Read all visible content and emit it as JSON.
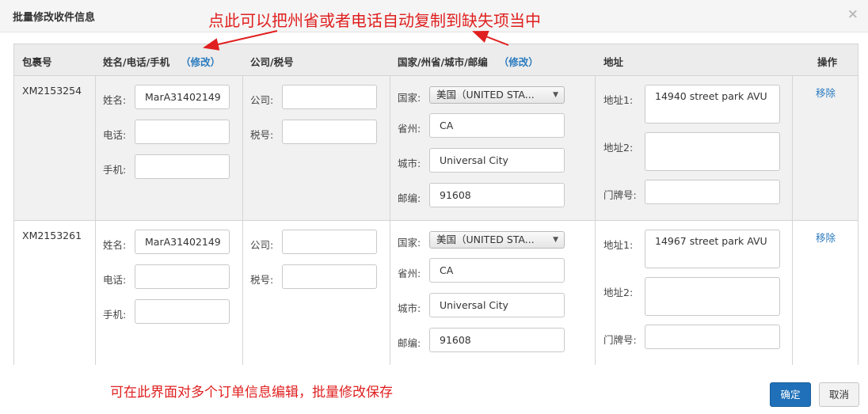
{
  "dialog": {
    "title": "批量修改收件信息",
    "close": "×",
    "annotation_top": "点此可以把州省或者电话自动复制到缺失项当中",
    "annotation_bottom": "可在此界面对多个订单信息编辑，批量修改保存",
    "annotation_color": "#e02020"
  },
  "table": {
    "headers": {
      "package": "包裹号",
      "name_phone": "姓名/电话/手机",
      "company_tax": "公司/税号",
      "region": "国家/州省/城市/邮编",
      "address": "地址",
      "actions": "操作",
      "edit_link": "（修改）"
    },
    "labels": {
      "name": "姓名:",
      "phone": "电话:",
      "mobile": "手机:",
      "company": "公司:",
      "tax": "税号:",
      "country": "国家:",
      "state": "省州:",
      "city": "城市:",
      "zip": "邮编:",
      "address1": "地址1:",
      "address2": "地址2:",
      "house_no": "门牌号:"
    },
    "remove_label": "移除",
    "rows": [
      {
        "package_id": "XM2153254",
        "name": "MarA31402149",
        "phone": "",
        "mobile": "",
        "company": "",
        "tax": "",
        "country": "美国（UNITED STA...",
        "state": "CA",
        "city": "Universal City",
        "zip": "91608",
        "address1": "14940 street park AVU",
        "address2": "",
        "house_no": ""
      },
      {
        "package_id": "XM2153261",
        "name": "MarA31402149",
        "phone": "",
        "mobile": "",
        "company": "",
        "tax": "",
        "country": "美国（UNITED STA...",
        "state": "CA",
        "city": "Universal City",
        "zip": "91608",
        "address1": "14967 street park AVU",
        "address2": "",
        "house_no": ""
      }
    ]
  },
  "footer": {
    "confirm": "确定",
    "cancel": "取消"
  },
  "colors": {
    "primary": "#1f70b8",
    "link": "#2a7bbf"
  }
}
